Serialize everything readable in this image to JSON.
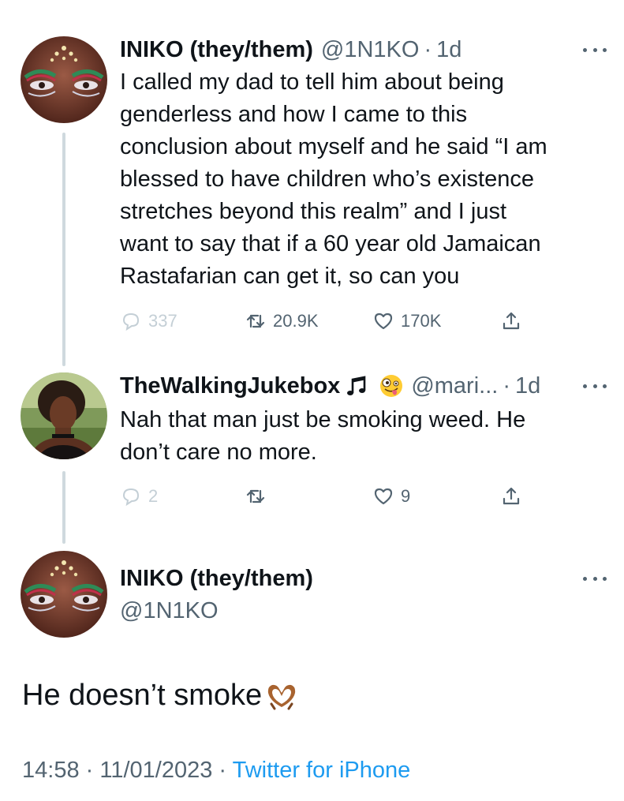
{
  "tweets": [
    {
      "name": "INIKO (they/them)",
      "handle": "@1N1KO",
      "sep": "·",
      "time": "1d",
      "avatar_icon": "avatar-face-gems",
      "text_lines": [
        "I called my dad to tell him about being",
        "genderless and how I came to this",
        "conclusion about myself and he said “I am",
        "blessed to have children who’s existence",
        "stretches beyond this realm” and I just",
        "want to say that if a 60 year old Jamaican",
        "Rastafarian can get it, so can you"
      ],
      "replies": "337",
      "retweets": "20.9K",
      "likes": "170K"
    },
    {
      "name": "TheWalkingJukebox",
      "emojis": [
        "music-notes-icon",
        "zany-face-emoji"
      ],
      "handle": "@mari...",
      "sep": "·",
      "time": "1d",
      "avatar_icon": "avatar-photo",
      "text_lines": [
        "Nah that man just be smoking weed. He",
        "don’t care no more."
      ],
      "replies": "2",
      "retweets": "",
      "likes": "9"
    }
  ],
  "focus": {
    "name": "INIKO (they/them)",
    "handle": "@1N1KO",
    "text": "He doesn’t smoke",
    "emoji": "heart-hands-emoji",
    "date": "14:58 · 11/01/2023 ·",
    "source": "Twitter for iPhone"
  },
  "colors": {
    "text": "#0f1419",
    "secondary": "#536471",
    "link": "#1d9bf0",
    "thread_line": "#cfd9de"
  }
}
